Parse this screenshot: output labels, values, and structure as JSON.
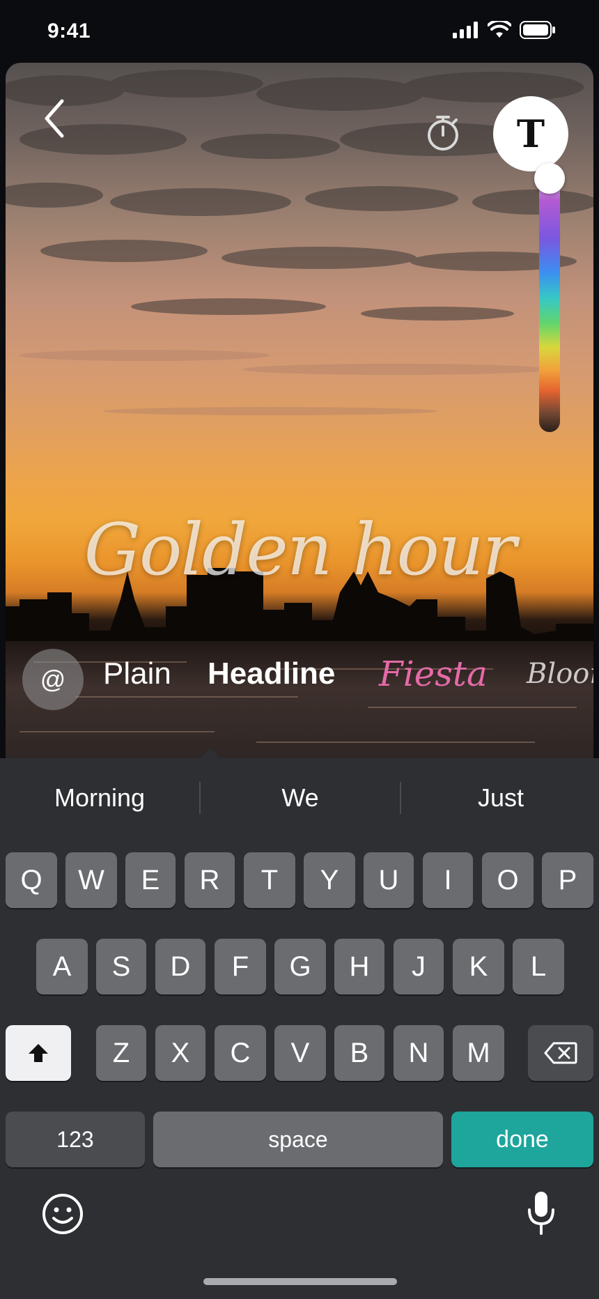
{
  "status_bar": {
    "time": "9:41"
  },
  "toolbar": {
    "text_tool_label": "T"
  },
  "canvas": {
    "overlay_text": "Golden hour",
    "color_slider_level": 0.0
  },
  "font_styles": {
    "mention_label": "@",
    "options": [
      "Plain",
      "Headline",
      "Fiesta",
      "Bloom"
    ],
    "fiesta_color": "#e46aa8"
  },
  "keyboard": {
    "predictions": [
      "Morning",
      "We",
      "Just"
    ],
    "row1": [
      "Q",
      "W",
      "E",
      "R",
      "T",
      "Y",
      "U",
      "I",
      "O",
      "P"
    ],
    "row2": [
      "A",
      "S",
      "D",
      "F",
      "G",
      "H",
      "J",
      "K",
      "L"
    ],
    "row3": [
      "Z",
      "X",
      "C",
      "V",
      "B",
      "N",
      "M"
    ],
    "numbers_label": "123",
    "space_label": "space",
    "done_label": "done",
    "done_color": "#1ea59c"
  }
}
